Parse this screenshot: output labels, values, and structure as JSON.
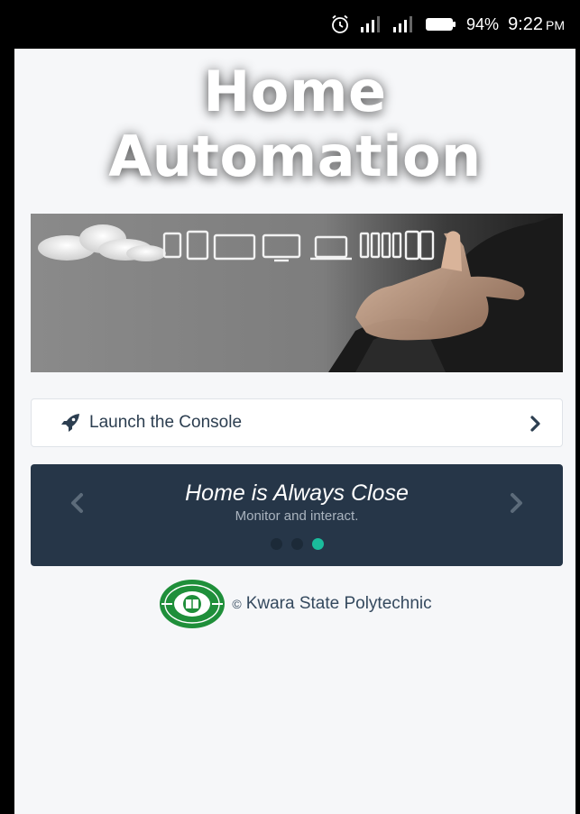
{
  "status_bar": {
    "battery_percent": "94%",
    "time": "9:22",
    "ampm": "PM",
    "icons": [
      "alarm-icon",
      "signal-icon",
      "signal-icon",
      "battery-icon"
    ]
  },
  "hero": {
    "title_line1": "Home",
    "title_line2": "Automation"
  },
  "launch": {
    "label": "Launch the Console",
    "icon": "rocket-icon"
  },
  "carousel": {
    "title": "Home is Always Close",
    "subtitle": "Monitor and interact.",
    "slide_count": 3,
    "active_index": 2
  },
  "footer": {
    "copyright_symbol": "©",
    "institution": "Kwara State Polytechnic",
    "logo_text": "KWARA STATE POLYTECHNIC"
  },
  "colors": {
    "carousel_bg": "#263648",
    "accent": "#1abc9c",
    "text_dark": "#2c3e50",
    "logo_green": "#1f8f3a"
  }
}
